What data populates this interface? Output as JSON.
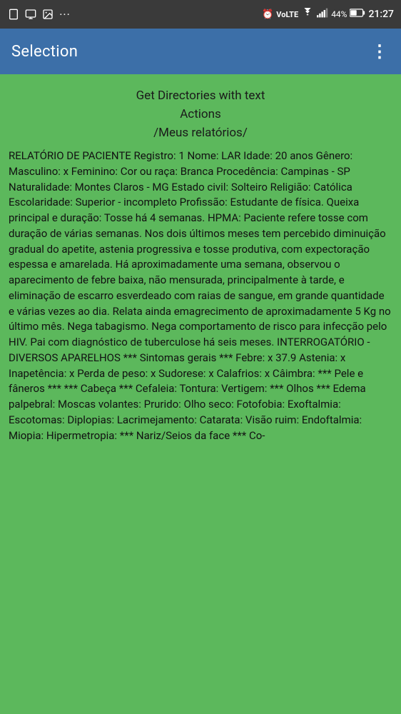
{
  "statusBar": {
    "leftIcons": [
      "phone-icon",
      "screen-icon",
      "image-icon",
      "more-icon"
    ],
    "time": "21:27",
    "battery": "44%",
    "signal": "Vo LTE",
    "wifi": "wifi-icon"
  },
  "appBar": {
    "title": "Selection",
    "menuIcon": "⋮"
  },
  "content": {
    "getDirectoriesLabel": "Get Directories with text",
    "actionsLabel": "Actions",
    "pathLabel": "/Meus relatórios/",
    "reportText": "RELATÓRIO DE PACIENTE Registro: 1 Nome: LAR Idade: 20 anos Gênero: Masculino: x Feminino: Cor ou raça: Branca Procedência: Campinas - SP Naturalidade: Montes Claros - MG Estado civil: Solteiro Religião: Católica Escolaridade: Superior - incompleto Profissão: Estudante de física. Queixa principal e duração: Tosse há 4 semanas. HPMA: Paciente refere tosse com duração de várias semanas. Nos dois últimos meses tem percebido diminuição gradual do apetite, astenia progressiva e tosse produtiva, com expectoração espessa e amarelada. Há aproximadamente uma semana, observou o aparecimento de febre baixa, não mensurada, principalmente à tarde, e eliminação de escarro esverdeado com raias de sangue, em grande quantidade e várias vezes ao dia. Relata ainda emagrecimento de aproximadamente 5 Kg no último mês. Nega tabagismo. Nega comportamento de risco para infecção pelo HIV. Pai com diagnóstico de tuberculose há seis meses. INTERROGATÓRIO - DIVERSOS APARELHOS *** Sintomas gerais *** Febre: x 37.9 Astenia: x Inapetência: x Perda de peso: x Sudorese: x Calafrios: x Câimbra: *** Pele e fâneros *** *** Cabeça *** Cefaleia: Tontura: Vertigem: *** Olhos *** Edema palpebral: Moscas volantes: Prurido: Olho seco: Fotofobia: Exoftalmia: Escotomas: Diplopias: Lacrimejamento: Catarata: Visão ruim: Endoftalmia: Miopia: Hipermetropia: *** Nariz/Seios da face *** Co-"
  }
}
